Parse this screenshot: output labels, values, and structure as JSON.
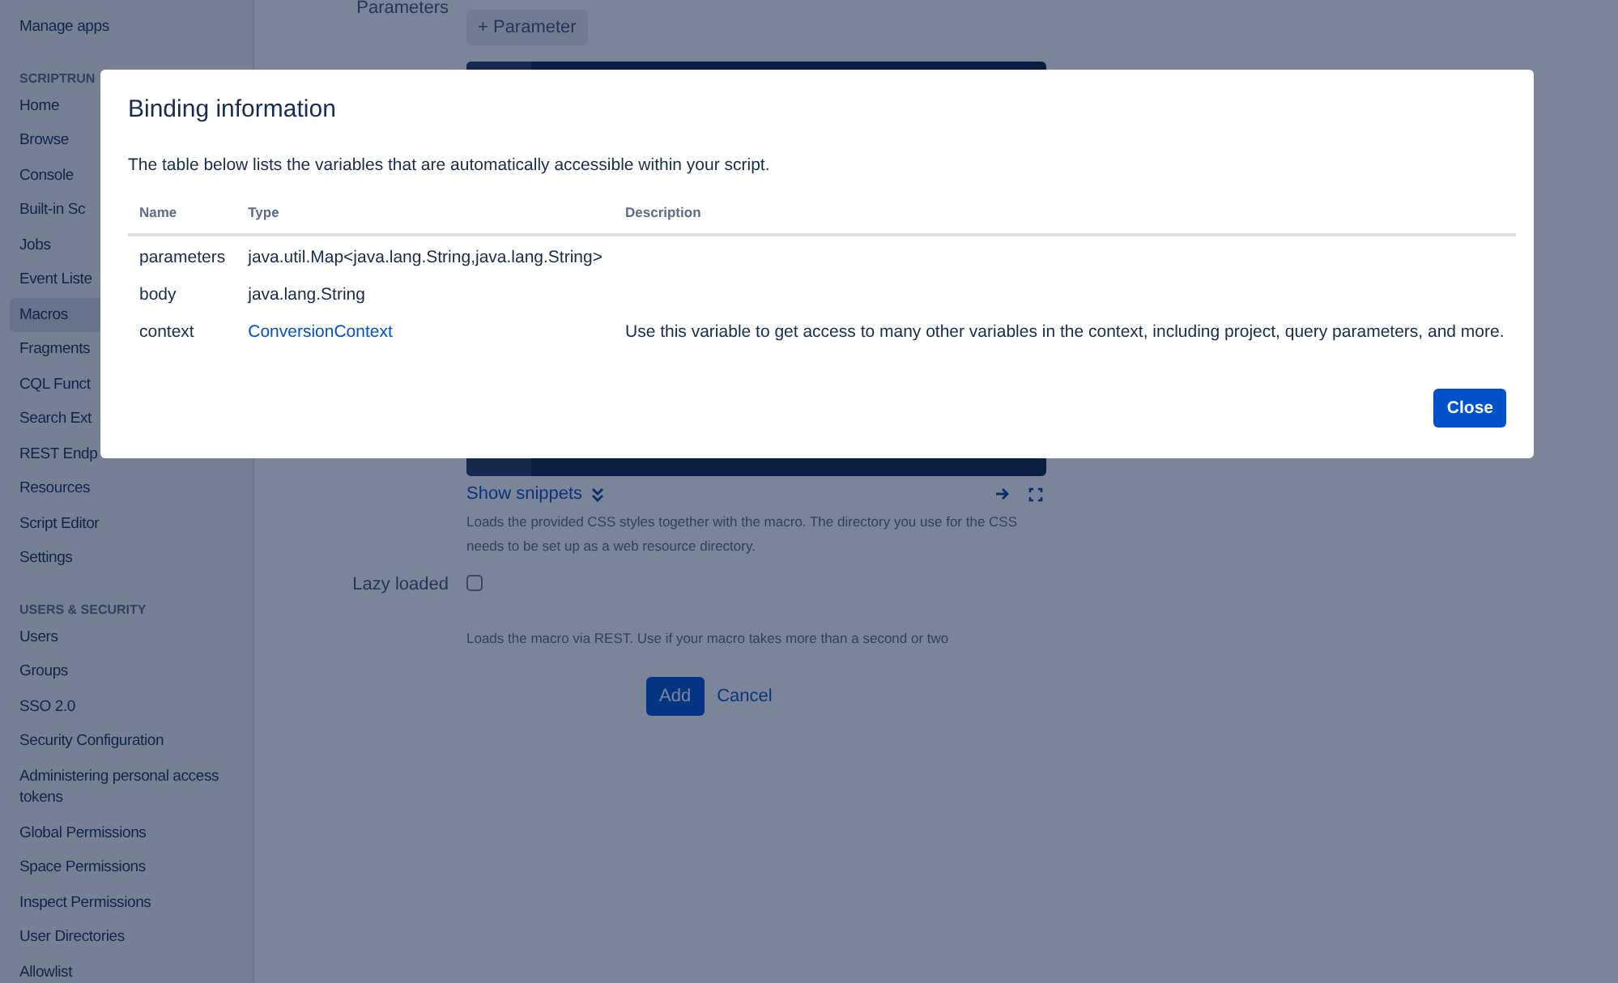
{
  "sidebar": {
    "sections": [
      {
        "items": [
          {
            "label": "Manage apps",
            "selected": false
          }
        ]
      },
      {
        "heading": "SCRIPTRUN",
        "items": [
          {
            "label": "Home",
            "selected": false
          },
          {
            "label": "Browse",
            "selected": false
          },
          {
            "label": "Console",
            "selected": false
          },
          {
            "label": "Built-in Sc",
            "selected": false
          },
          {
            "label": "Jobs",
            "selected": false
          },
          {
            "label": "Event Liste",
            "selected": false
          },
          {
            "label": "Macros",
            "selected": true
          },
          {
            "label": "Fragments",
            "selected": false
          },
          {
            "label": "CQL Funct",
            "selected": false
          },
          {
            "label": "Search Ext",
            "selected": false
          },
          {
            "label": "REST Endp",
            "selected": false
          },
          {
            "label": "Resources",
            "selected": false
          },
          {
            "label": "Script Editor",
            "selected": false
          },
          {
            "label": "Settings",
            "selected": false
          }
        ]
      },
      {
        "heading": "USERS & SECURITY",
        "items": [
          {
            "label": "Users",
            "selected": false
          },
          {
            "label": "Groups",
            "selected": false
          },
          {
            "label": "SSO 2.0",
            "selected": false
          },
          {
            "label": "Security Configuration",
            "selected": false
          },
          {
            "label": "Administering personal access tokens",
            "selected": false
          },
          {
            "label": "Global Permissions",
            "selected": false
          },
          {
            "label": "Space Permissions",
            "selected": false
          },
          {
            "label": "Inspect Permissions",
            "selected": false
          },
          {
            "label": "User Directories",
            "selected": false
          },
          {
            "label": "Allowlist",
            "selected": false
          }
        ]
      }
    ]
  },
  "form": {
    "parameters_label": "Parameters",
    "add_parameter_button": "+ Parameter",
    "show_snippets": "Show snippets",
    "css_help": "Loads the provided CSS styles together with the macro. The directory you use for the CSS needs to be set up as a web resource directory.",
    "lazy_loaded": {
      "label": "Lazy loaded",
      "checked": false,
      "help": "Loads the macro via REST. Use if your macro takes more than a second or two"
    },
    "buttons": {
      "add": "Add",
      "cancel": "Cancel"
    }
  },
  "dialog": {
    "title": "Binding information",
    "description": "The table below lists the variables that are automatically accessible within your script.",
    "columns": [
      "Name",
      "Type",
      "Description"
    ],
    "rows": [
      {
        "name": "parameters",
        "type": "java.util.Map<java.lang.String,java.lang.String>",
        "type_link": false
      },
      {
        "name": "body",
        "type": "java.lang.String",
        "type_link": false
      },
      {
        "name": "context",
        "type": "ConversionContext",
        "type_link": true,
        "description": "Use this variable to get access to many other variables in the context, including project, query parameters, and more."
      }
    ],
    "close_button": "Close"
  }
}
